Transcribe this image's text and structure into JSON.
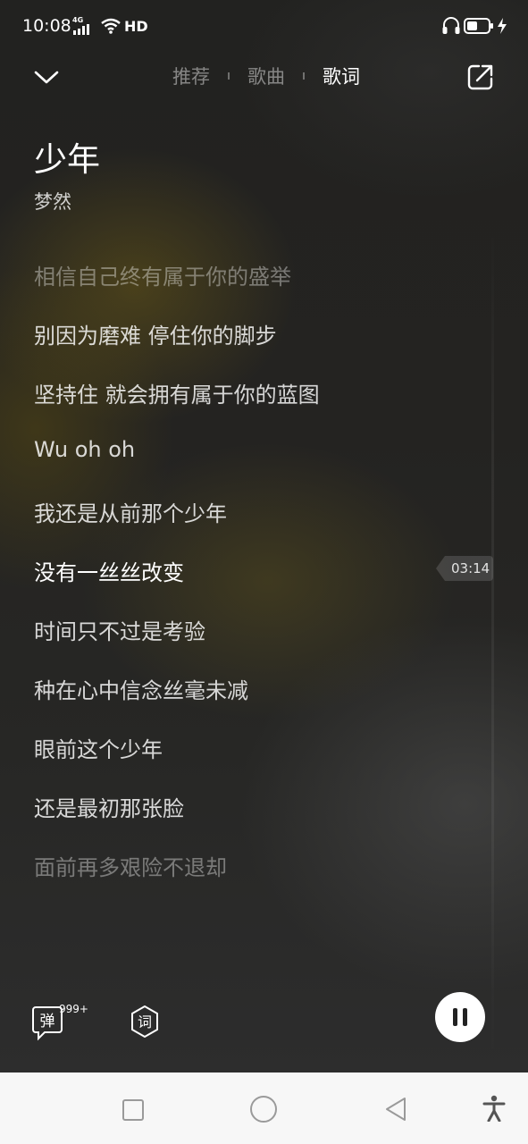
{
  "status_bar": {
    "time": "10:08",
    "network": "4G",
    "hd_label": "HD"
  },
  "nav": {
    "tabs": [
      {
        "label": "推荐",
        "active": false
      },
      {
        "label": "歌曲",
        "active": false
      },
      {
        "label": "歌词",
        "active": true
      }
    ]
  },
  "song": {
    "title": "少年",
    "artist": "梦然"
  },
  "lyrics": {
    "lines": [
      {
        "text": "相信自己终有属于你的盛举",
        "state": "faded"
      },
      {
        "text": "别因为磨难 停住你的脚步",
        "state": "normal"
      },
      {
        "text": "坚持住 就会拥有属于你的蓝图",
        "state": "normal"
      },
      {
        "text": "Wu oh oh",
        "state": "normal"
      },
      {
        "text": "我还是从前那个少年",
        "state": "normal"
      },
      {
        "text": "没有一丝丝改变",
        "state": "current"
      },
      {
        "text": "时间只不过是考验",
        "state": "normal"
      },
      {
        "text": "种在心中信念丝毫未减",
        "state": "normal"
      },
      {
        "text": "眼前这个少年",
        "state": "normal"
      },
      {
        "text": "还是最初那张脸",
        "state": "normal"
      },
      {
        "text": "面前再多艰险不退却",
        "state": "faded"
      }
    ],
    "current_time": "03:14"
  },
  "controls": {
    "danmu_label": "弹",
    "danmu_count": "999+",
    "lyric_label": "词"
  },
  "icons": {
    "back": "chevron-down-icon",
    "share": "share-icon",
    "pause": "pause-icon",
    "headset": "headset-icon",
    "battery": "battery-icon"
  },
  "colors": {
    "background": "#222220",
    "accent_glow": "#786414",
    "navbar": "#f7f7f7"
  }
}
